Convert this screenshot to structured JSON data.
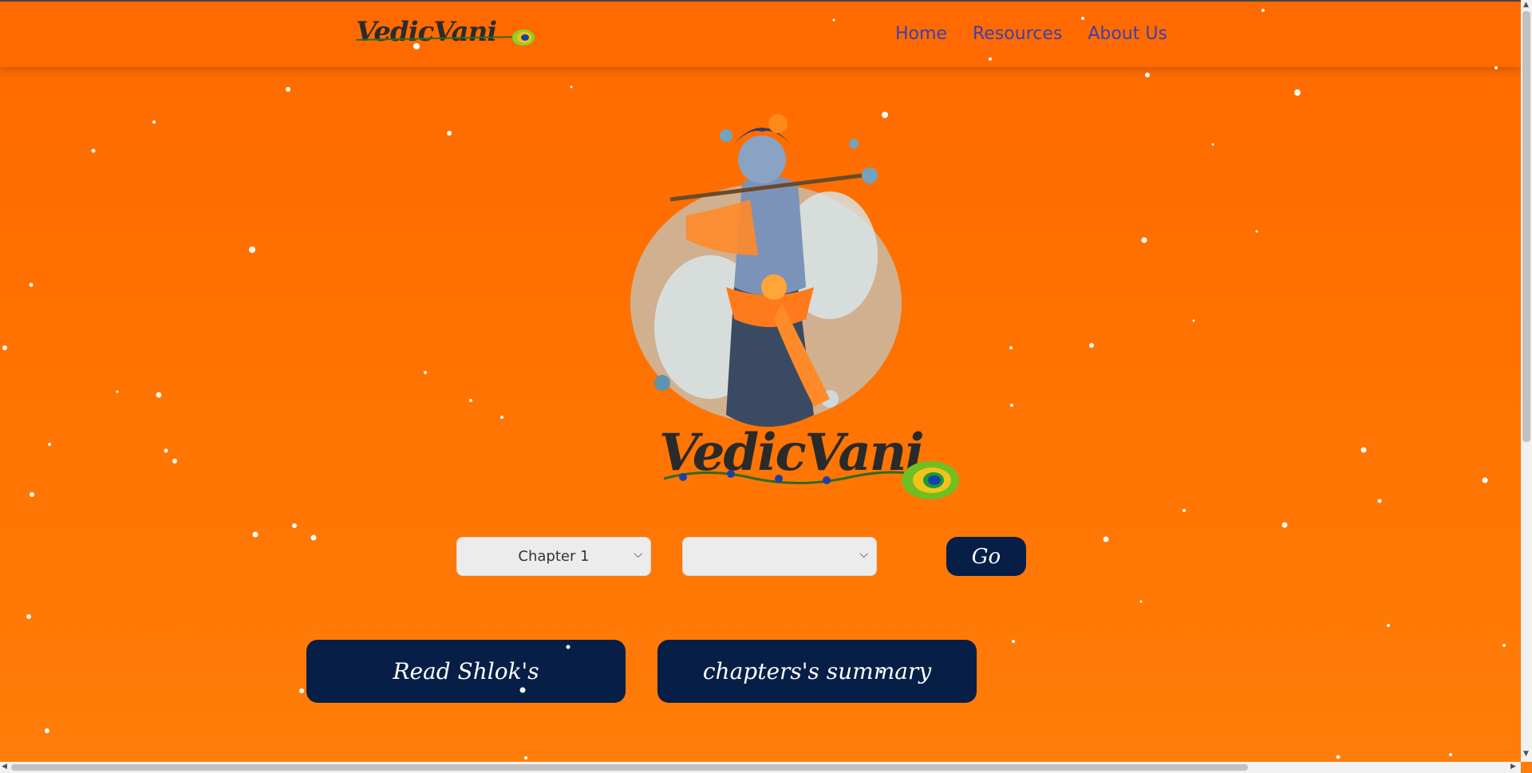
{
  "navbar": {
    "logo_text": "VedicVani",
    "links": [
      "Home",
      "Resources",
      "About Us"
    ]
  },
  "hero": {
    "logo_text": "VedicVani"
  },
  "controls": {
    "chapter_select_value": "Chapter 1",
    "verse_select_value": "",
    "go_label": "Go"
  },
  "actions": {
    "read_shloks_label": "Read Shlok's",
    "summary_label": "chapters's summary"
  },
  "colors": {
    "background": "#ff6a00",
    "button": "#071f47",
    "link": "#3b3fb0"
  }
}
